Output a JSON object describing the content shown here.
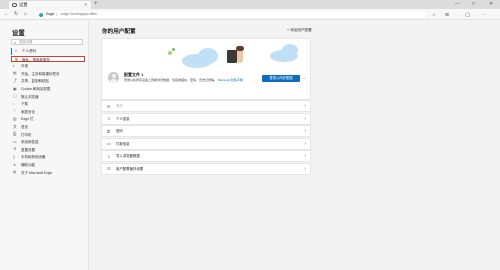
{
  "tab": {
    "title": "设置",
    "close": "×",
    "new_tab": "+"
  },
  "window_controls": {
    "minimize": "—",
    "maximize": "□",
    "close": "✕"
  },
  "address": {
    "brand": "Edge",
    "separator": "|",
    "url": "edge://settings/profiles"
  },
  "nav": {
    "back": "←",
    "refresh": "↻",
    "home": "⌂"
  },
  "toolbar": {
    "favorite": "☆",
    "collections": "⊞",
    "account": "◯",
    "more": "···"
  },
  "sidebar": {
    "title": "设置",
    "search_placeholder": "搜索设置",
    "items": [
      {
        "icon": "person-icon",
        "glyph": "☺",
        "label": "个人资料"
      },
      {
        "icon": "lock-icon",
        "glyph": "🔒",
        "label": "隐私、搜索和服务"
      },
      {
        "icon": "appearance-icon",
        "glyph": "◐",
        "label": "外观"
      },
      {
        "icon": "sidebar-icon",
        "glyph": "▤",
        "label": "开始、主页和新建标签页"
      },
      {
        "icon": "share-icon",
        "glyph": "⤴",
        "label": "共享、复制和粘贴"
      },
      {
        "icon": "cookie-icon",
        "glyph": "▣",
        "label": "Cookie 和网站权限"
      },
      {
        "icon": "browser-icon",
        "glyph": "▢",
        "label": "默认浏览器"
      },
      {
        "icon": "download-icon",
        "glyph": "↓",
        "label": "下载"
      },
      {
        "icon": "family-icon",
        "glyph": "♡",
        "label": "家庭安全"
      },
      {
        "icon": "edge-bar-icon",
        "glyph": "▥",
        "label": "Edge 栏"
      },
      {
        "icon": "language-icon",
        "glyph": "文",
        "label": "语言"
      },
      {
        "icon": "printer-icon",
        "glyph": "⎙",
        "label": "打印机"
      },
      {
        "icon": "system-icon",
        "glyph": "▭",
        "label": "系统和性能"
      },
      {
        "icon": "reset-icon",
        "glyph": "↺",
        "label": "重置设置"
      },
      {
        "icon": "phone-icon",
        "glyph": "▯",
        "label": "手机和其他设备"
      },
      {
        "icon": "accessibility-icon",
        "glyph": "♿",
        "label": "辅助功能"
      },
      {
        "icon": "edge-icon",
        "glyph": "◍",
        "label": "关于 Microsoft Edge"
      }
    ]
  },
  "main": {
    "title": "你的用户配置",
    "add_profile": "+ 添加用户配置",
    "profile": {
      "name": "配置文件 1",
      "description": "登录以在所有设备上查看浏览数据，包括收藏夹、密码、历史记录等。",
      "link": "Microsoft 隐私声明",
      "sync_button": "登录以同步数据",
      "more": "···"
    },
    "rows": [
      {
        "icon": "sync-icon",
        "glyph": "⟳",
        "label": "同步",
        "muted": true
      },
      {
        "icon": "person-icon",
        "glyph": "☺",
        "label": "个人信息",
        "muted": false
      },
      {
        "icon": "key-icon",
        "glyph": "⚿",
        "label": "密码",
        "muted": false
      },
      {
        "icon": "card-icon",
        "glyph": "▭",
        "label": "付款信息",
        "muted": false
      },
      {
        "icon": "import-icon",
        "glyph": "⇩",
        "label": "导入浏览器数据",
        "muted": false
      },
      {
        "icon": "profile-pref-icon",
        "glyph": "☷",
        "label": "用户配置偏好设置",
        "muted": false
      }
    ],
    "chevron": "›"
  },
  "colors": {
    "accent": "#0f6cbd",
    "highlight": "#e03535"
  }
}
